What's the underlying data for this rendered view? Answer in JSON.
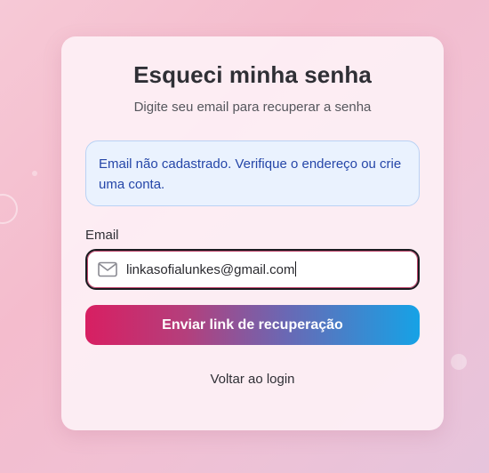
{
  "card": {
    "title": "Esqueci minha senha",
    "subtitle": "Digite seu email para recuperar a senha"
  },
  "alert": {
    "message": "Email não cadastrado. Verifique o endereço ou crie uma conta."
  },
  "form": {
    "email_label": "Email",
    "email_value": "linkasofialunkes@gmail.com",
    "email_icon": "mail-icon",
    "submit_label": "Enviar link de recuperação"
  },
  "back_link": "Voltar ao login",
  "colors": {
    "alert_bg": "#eaf2fe",
    "alert_text": "#2546a8",
    "button_gradient_start": "#d81f62",
    "button_gradient_end": "#16a2e6"
  }
}
